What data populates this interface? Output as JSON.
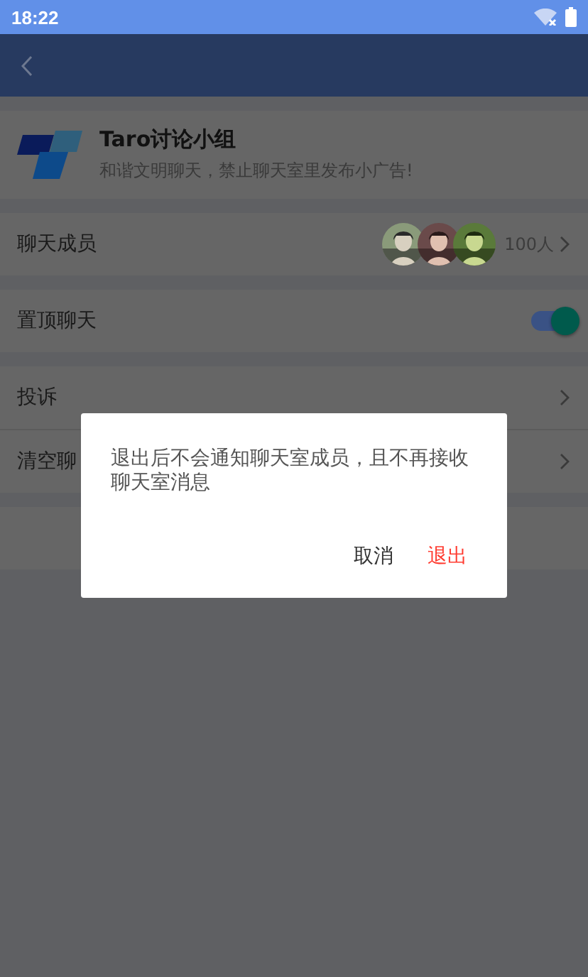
{
  "status_bar": {
    "time": "18:22"
  },
  "group": {
    "name": "Taro讨论小组",
    "description": "和谐文明聊天，禁止聊天室里发布小广告!"
  },
  "sections": [
    {
      "rows": [
        {
          "kind": "members",
          "label": "聊天成员",
          "count": "100人"
        }
      ]
    },
    {
      "rows": [
        {
          "kind": "toggle",
          "label": "置顶聊天",
          "on": true
        }
      ]
    },
    {
      "rows": [
        {
          "kind": "link",
          "label": "投诉"
        },
        {
          "kind": "link",
          "label": "清空聊"
        }
      ]
    },
    {
      "rows": [
        {
          "kind": "blank"
        }
      ]
    }
  ],
  "dialog": {
    "message": "退出后不会通知聊天室成员，且不再接收聊天室消息",
    "buttons": [
      {
        "label": "取消",
        "kind": "cancel"
      },
      {
        "label": "退出",
        "kind": "danger"
      }
    ]
  }
}
